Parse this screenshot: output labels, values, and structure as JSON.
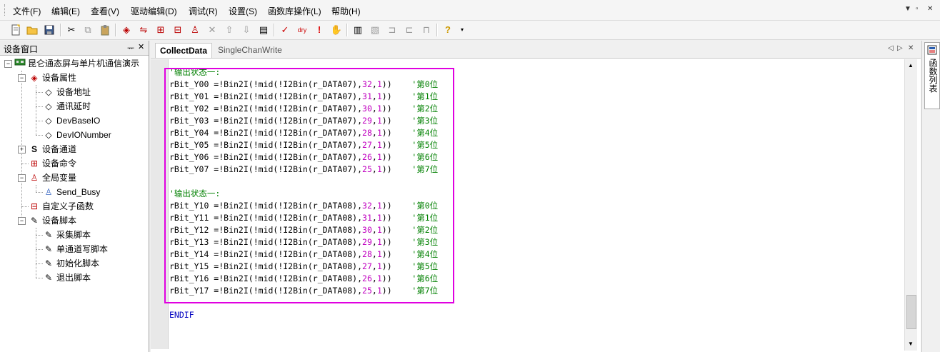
{
  "menu": {
    "items": [
      "文件(F)",
      "编辑(E)",
      "查看(V)",
      "驱动编辑(D)",
      "调试(R)",
      "设置(S)",
      "函数库操作(L)",
      "帮助(H)"
    ],
    "window_controls": [
      "▼",
      "▫",
      "✕"
    ]
  },
  "toolbar": {
    "icons": [
      "new-file-icon",
      "open-folder-icon",
      "save-icon",
      "cut-icon",
      "copy-icon",
      "paste-icon",
      "driver-icon",
      "channel-icon",
      "command-icon",
      "subfunc-icon",
      "variable-icon",
      "delete-icon",
      "move-up-icon",
      "move-down-icon",
      "properties-icon",
      "check-icon",
      "dry-run-icon",
      "exclamation-icon",
      "hand-icon",
      "dev-a-icon",
      "dev-b-icon",
      "dev-c-icon",
      "dev-d-icon",
      "dev-e-icon",
      "help-icon",
      "dropdown-icon"
    ]
  },
  "device_panel": {
    "title": "设备窗口",
    "pin": "ᅲ",
    "close": "✕",
    "tree": {
      "root": "昆仑通态屏与单片机通信演示",
      "properties": "设备属性",
      "prop_children": [
        "设备地址",
        "通讯延时",
        "DevBaseIO",
        "DevIONumber"
      ],
      "channel": "设备通道",
      "command": "设备命令",
      "globals": "全局变量",
      "global_children": [
        "Send_Busy"
      ],
      "subfunc": "自定义子函数",
      "scripts": "设备脚本",
      "script_children": [
        "采集脚本",
        "单通道写脚本",
        "初始化脚本",
        "退出脚本"
      ]
    }
  },
  "editor": {
    "tabs": [
      "CollectData",
      "SingleChanWrite"
    ],
    "tab_controls": [
      "◁",
      "▷",
      "✕"
    ],
    "block1": {
      "comment": "'输出状态一:",
      "lines": [
        {
          "pre": "rBit_Y00 =!Bin2I(!mid(!I2Bin(r_DATA07),",
          "a": "32",
          "mid": ",",
          "b": "1",
          "post": "))",
          "cmt": "'第0位"
        },
        {
          "pre": "rBit_Y01 =!Bin2I(!mid(!I2Bin(r_DATA07),",
          "a": "31",
          "mid": ",",
          "b": "1",
          "post": "))",
          "cmt": "'第1位"
        },
        {
          "pre": "rBit_Y02 =!Bin2I(!mid(!I2Bin(r_DATA07),",
          "a": "30",
          "mid": ",",
          "b": "1",
          "post": "))",
          "cmt": "'第2位"
        },
        {
          "pre": "rBit_Y03 =!Bin2I(!mid(!I2Bin(r_DATA07),",
          "a": "29",
          "mid": ",",
          "b": "1",
          "post": "))",
          "cmt": "'第3位"
        },
        {
          "pre": "rBit_Y04 =!Bin2I(!mid(!I2Bin(r_DATA07),",
          "a": "28",
          "mid": ",",
          "b": "1",
          "post": "))",
          "cmt": "'第4位"
        },
        {
          "pre": "rBit_Y05 =!Bin2I(!mid(!I2Bin(r_DATA07),",
          "a": "27",
          "mid": ",",
          "b": "1",
          "post": "))",
          "cmt": "'第5位"
        },
        {
          "pre": "rBit_Y06 =!Bin2I(!mid(!I2Bin(r_DATA07),",
          "a": "26",
          "mid": ",",
          "b": "1",
          "post": "))",
          "cmt": "'第6位"
        },
        {
          "pre": "rBit_Y07 =!Bin2I(!mid(!I2Bin(r_DATA07),",
          "a": "25",
          "mid": ",",
          "b": "1",
          "post": "))",
          "cmt": "'第7位"
        }
      ]
    },
    "block2": {
      "comment": "'输出状态一:",
      "lines": [
        {
          "pre": "rBit_Y10 =!Bin2I(!mid(!I2Bin(r_DATA08),",
          "a": "32",
          "mid": ",",
          "b": "1",
          "post": "))",
          "cmt": "'第0位"
        },
        {
          "pre": "rBit_Y11 =!Bin2I(!mid(!I2Bin(r_DATA08),",
          "a": "31",
          "mid": ",",
          "b": "1",
          "post": "))",
          "cmt": "'第1位"
        },
        {
          "pre": "rBit_Y12 =!Bin2I(!mid(!I2Bin(r_DATA08),",
          "a": "30",
          "mid": ",",
          "b": "1",
          "post": "))",
          "cmt": "'第2位"
        },
        {
          "pre": "rBit_Y13 =!Bin2I(!mid(!I2Bin(r_DATA08),",
          "a": "29",
          "mid": ",",
          "b": "1",
          "post": "))",
          "cmt": "'第3位"
        },
        {
          "pre": "rBit_Y14 =!Bin2I(!mid(!I2Bin(r_DATA08),",
          "a": "28",
          "mid": ",",
          "b": "1",
          "post": "))",
          "cmt": "'第4位"
        },
        {
          "pre": "rBit_Y15 =!Bin2I(!mid(!I2Bin(r_DATA08),",
          "a": "27",
          "mid": ",",
          "b": "1",
          "post": "))",
          "cmt": "'第5位"
        },
        {
          "pre": "rBit_Y16 =!Bin2I(!mid(!I2Bin(r_DATA08),",
          "a": "26",
          "mid": ",",
          "b": "1",
          "post": "))",
          "cmt": "'第6位"
        },
        {
          "pre": "rBit_Y17 =!Bin2I(!mid(!I2Bin(r_DATA08),",
          "a": "25",
          "mid": ",",
          "b": "1",
          "post": "))",
          "cmt": "'第7位"
        }
      ]
    },
    "endif": "ENDIF"
  },
  "right_panel": {
    "tab_label": "函数列表"
  },
  "colors": {
    "comment": "#008000",
    "number": "#c000c0",
    "keyword": "#0000c0",
    "highlight_box": "#e000e0"
  }
}
